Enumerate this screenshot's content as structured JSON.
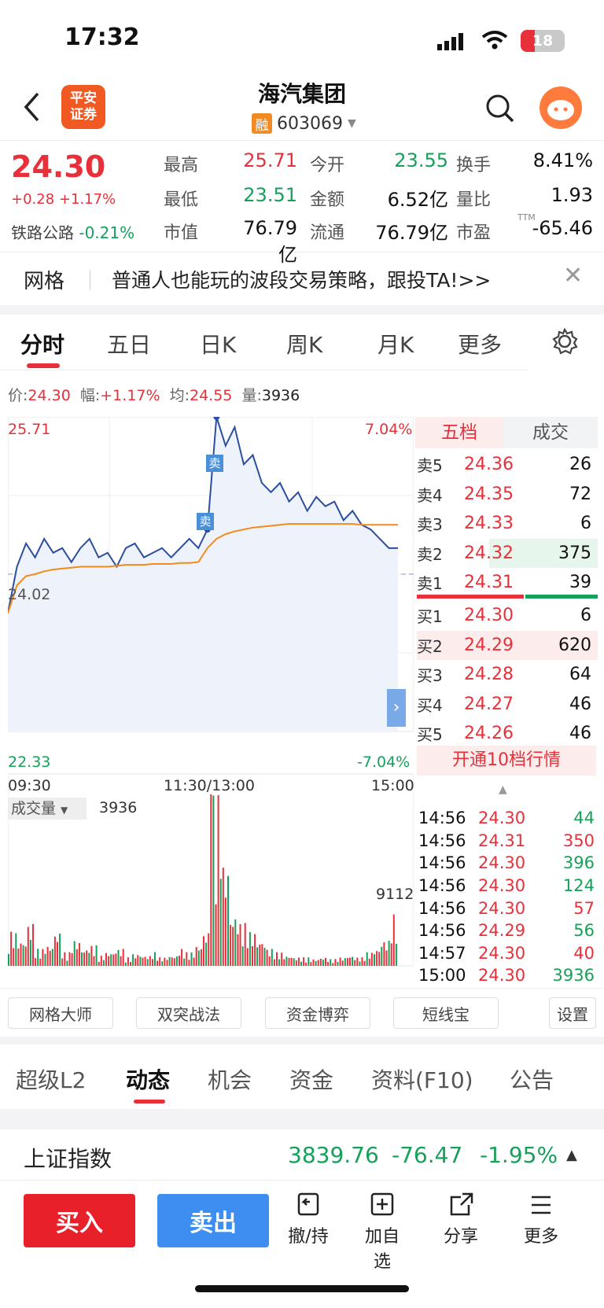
{
  "status": {
    "time": "17:32",
    "battery": "18"
  },
  "header": {
    "title": "海汽集团",
    "code": "603069",
    "margin_badge": "融",
    "brand": [
      "平安",
      "证券"
    ]
  },
  "quote": {
    "price": "24.30",
    "change": "+0.28 +1.17%",
    "sector_name": "铁路公路",
    "sector_change": "-0.21%",
    "stats": [
      {
        "label": "最高",
        "value": "25.71"
      },
      {
        "label": "今开",
        "value": "23.55"
      },
      {
        "label": "换手",
        "value": "8.41%"
      },
      {
        "label": "最低",
        "value": "23.51"
      },
      {
        "label": "金额",
        "value": "6.52亿"
      },
      {
        "label": "量比",
        "value": "1.93"
      },
      {
        "label": "市值",
        "value": "76.79亿"
      },
      {
        "label": "流通",
        "value": "76.79亿"
      },
      {
        "label": "市盈",
        "value": "-65.46"
      }
    ],
    "ttm": "TTM"
  },
  "banner": {
    "tag": "网格",
    "text": "普通人也能玩的波段交易策略，跟投TA!>>"
  },
  "tabs": [
    "分时",
    "五日",
    "日K",
    "周K",
    "月K",
    "更多"
  ],
  "info_line": {
    "price_lbl": "价:",
    "price": "24.30",
    "amp_lbl": "幅:",
    "amp": "+1.17%",
    "avg_lbl": "均:",
    "avg": "24.55",
    "vol_lbl": "量:",
    "vol": "3936"
  },
  "chart": {
    "top_left": "25.71",
    "top_right": "7.04%",
    "bottom_left": "22.33",
    "bottom_right": "-7.04%",
    "mid_label": "24.02",
    "time_labels": [
      "09:30",
      "11:30/13:00",
      "15:00"
    ],
    "sell_marker": "卖",
    "volume_title": "成交量",
    "volume_value": "3936",
    "volume_max": "9112"
  },
  "chart_data": {
    "type": "line",
    "series": [
      {
        "values": [
          23.6,
          24.1,
          24.35,
          24.2,
          24.4,
          24.25,
          24.3,
          24.15,
          24.3,
          24.4,
          24.2,
          24.25,
          24.1,
          24.3,
          24.35,
          24.2,
          24.25,
          24.3,
          24.2,
          24.3,
          24.4,
          24.3,
          24.5,
          25.71,
          25.4,
          25.6,
          25.2,
          25.3,
          25.0,
          24.9,
          25.0,
          24.8,
          24.9,
          24.7,
          24.85,
          24.75,
          24.8,
          24.6,
          24.7,
          24.55,
          24.5,
          24.4,
          24.3,
          24.3
        ]
      },
      {
        "values": [
          23.6,
          23.9,
          24.0,
          24.02,
          24.05,
          24.07,
          24.08,
          24.09,
          24.1,
          24.1,
          24.1,
          24.1,
          24.11,
          24.12,
          24.12,
          24.12,
          24.13,
          24.13,
          24.13,
          24.14,
          24.14,
          24.15,
          24.3,
          24.4,
          24.45,
          24.48,
          24.5,
          24.52,
          24.53,
          24.54,
          24.55,
          24.56,
          24.56,
          24.56,
          24.56,
          24.56,
          24.56,
          24.56,
          24.56,
          24.55,
          24.55,
          24.55,
          24.55,
          24.55
        ]
      }
    ],
    "ylim": [
      22.33,
      25.71
    ],
    "volumes": [
      0.2,
      0.15,
      0.25,
      0.1,
      0.12,
      0.2,
      0.08,
      0.15,
      0.1,
      0.12,
      0.06,
      0.08,
      0.1,
      0.05,
      0.07,
      0.06,
      0.08,
      0.05,
      0.06,
      0.1,
      0.08,
      0.12,
      0.2,
      1.0,
      0.6,
      0.3,
      0.25,
      0.2,
      0.15,
      0.1,
      0.08,
      0.06,
      0.05,
      0.05,
      0.04,
      0.05,
      0.04,
      0.05,
      0.06,
      0.05,
      0.08,
      0.1,
      0.15,
      0.3
    ]
  },
  "orderbook": {
    "tab_active": "五档",
    "tab_other": "成交",
    "asks": [
      {
        "k": "卖5",
        "p": "24.36",
        "v": "26"
      },
      {
        "k": "卖4",
        "p": "24.35",
        "v": "72"
      },
      {
        "k": "卖3",
        "p": "24.33",
        "v": "6"
      },
      {
        "k": "卖2",
        "p": "24.32",
        "v": "375"
      },
      {
        "k": "卖1",
        "p": "24.31",
        "v": "39"
      }
    ],
    "bids": [
      {
        "k": "买1",
        "p": "24.30",
        "v": "6"
      },
      {
        "k": "买2",
        "p": "24.29",
        "v": "620"
      },
      {
        "k": "买3",
        "p": "24.28",
        "v": "64"
      },
      {
        "k": "买4",
        "p": "24.27",
        "v": "46"
      },
      {
        "k": "买5",
        "p": "24.26",
        "v": "46"
      }
    ],
    "upgrade": "开通10档行情"
  },
  "ticks": [
    {
      "t": "14:56",
      "p": "24.30",
      "v": "44",
      "c": "green"
    },
    {
      "t": "14:56",
      "p": "24.31",
      "v": "350",
      "c": "red"
    },
    {
      "t": "14:56",
      "p": "24.30",
      "v": "396",
      "c": "green"
    },
    {
      "t": "14:56",
      "p": "24.30",
      "v": "124",
      "c": "green"
    },
    {
      "t": "14:56",
      "p": "24.30",
      "v": "57",
      "c": "red"
    },
    {
      "t": "14:56",
      "p": "24.29",
      "v": "56",
      "c": "green"
    },
    {
      "t": "14:57",
      "p": "24.30",
      "v": "40",
      "c": "red"
    },
    {
      "t": "15:00",
      "p": "24.30",
      "v": "3936",
      "c": "green"
    }
  ],
  "tools": [
    "网格大师",
    "双突战法",
    "资金博弈",
    "短线宝",
    "设置"
  ],
  "feature_tabs": [
    "超级L2",
    "动态",
    "机会",
    "资金",
    "资料(F10)",
    "公告"
  ],
  "index": {
    "name": "上证指数",
    "value": "3839.76",
    "change": "-76.47",
    "pct": "-1.95%"
  },
  "bottom": {
    "buy": "买入",
    "sell": "卖出",
    "actions": [
      "撤/持",
      "加自选",
      "分享",
      "更多"
    ]
  }
}
